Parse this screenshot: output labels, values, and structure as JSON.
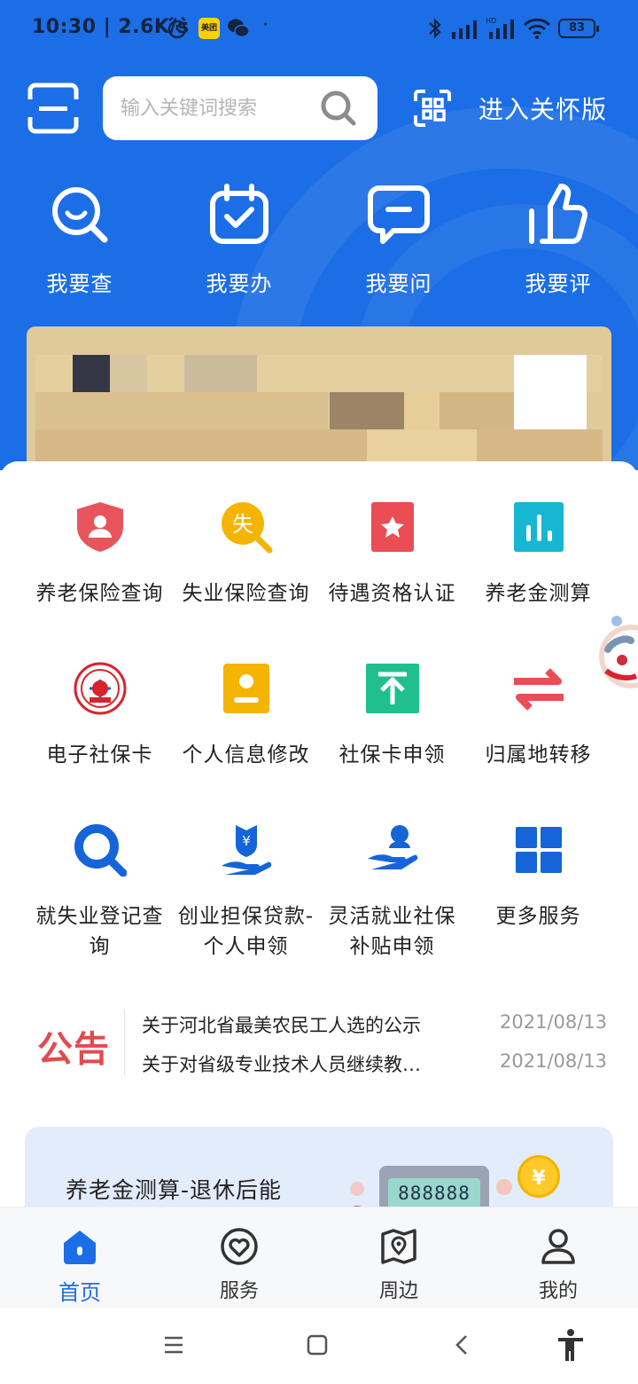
{
  "status_bar": {
    "time": "10:30",
    "net_speed": "| 2.6K/s",
    "meituan_badge": "美团",
    "dot": "·",
    "battery": "83"
  },
  "search": {
    "placeholder": "输入关键词搜索"
  },
  "care_version": "进入关怀版",
  "quick_actions": [
    {
      "label": "我要查",
      "icon": "magnifier-smile-icon"
    },
    {
      "label": "我要办",
      "icon": "calendar-check-icon"
    },
    {
      "label": "我要问",
      "icon": "chat-bubble-icon"
    },
    {
      "label": "我要评",
      "icon": "thumbs-up-icon"
    }
  ],
  "services": [
    {
      "label": "养老保险查询",
      "icon": "pension-shield-icon",
      "color": "#e8545b"
    },
    {
      "label": "失业保险查询",
      "icon": "unemployment-search-icon",
      "color": "#f5b400"
    },
    {
      "label": "待遇资格认证",
      "icon": "star-card-icon",
      "color": "#ea4d54"
    },
    {
      "label": "养老金测算",
      "icon": "bar-chart-icon",
      "color": "#17b6d3"
    },
    {
      "label": "电子社保卡",
      "icon": "social-security-card-icon",
      "color": "#d9232c"
    },
    {
      "label": "个人信息修改",
      "icon": "person-card-icon",
      "color": "#f5b400"
    },
    {
      "label": "社保卡申领",
      "icon": "upload-arrow-icon",
      "color": "#1fc08e"
    },
    {
      "label": "归属地转移",
      "icon": "swap-arrows-icon",
      "color": "#ea4d54"
    },
    {
      "label": "就失业登记查询",
      "icon": "magnifier-icon",
      "color": "#1565d8"
    },
    {
      "label": "创业担保贷款-个人申领",
      "icon": "hand-yen-icon",
      "color": "#1565d8"
    },
    {
      "label": "灵活就业社保补贴申领",
      "icon": "hand-person-icon",
      "color": "#1565d8"
    },
    {
      "label": "更多服务",
      "icon": "grid-icon",
      "color": "#1565d8"
    }
  ],
  "notice": {
    "logo": "公告",
    "items": [
      {
        "title": "关于河北省最美农民工人选的公示",
        "date": "2021/08/13"
      },
      {
        "title": "关于对省级专业技术人员继续教…",
        "date": "2021/08/13"
      }
    ]
  },
  "promo": {
    "text": "养老金测算-退休后能",
    "calc_display": "888888",
    "coin": "¥"
  },
  "tabs": [
    {
      "label": "首页",
      "icon": "home-icon",
      "active": true
    },
    {
      "label": "服务",
      "icon": "heart-circle-icon",
      "active": false
    },
    {
      "label": "周边",
      "icon": "map-pin-icon",
      "active": false
    },
    {
      "label": "我的",
      "icon": "person-icon",
      "active": false
    }
  ],
  "colors": {
    "brand_blue": "#1c6ee6",
    "notice_red": "#e14b4f"
  }
}
